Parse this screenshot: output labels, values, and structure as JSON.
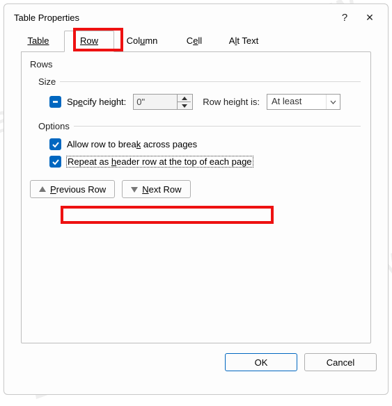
{
  "title": "Table Properties",
  "help_glyph": "?",
  "close_glyph": "✕",
  "tabs": {
    "table": "Table",
    "row": "Row",
    "column": "Column",
    "cell": "Cell",
    "alttext_pre": "A",
    "alttext_u": "l",
    "alttext_post": "t Text"
  },
  "rows_label": "Rows",
  "size": {
    "label": "Size",
    "specify_pre": "Sp",
    "specify_u": "e",
    "specify_post": "cify height:",
    "value": "0\"",
    "row_height_pre": "Row height ",
    "row_height_u": "i",
    "row_height_post": "s:",
    "mode": "At least"
  },
  "options": {
    "label_u": "O",
    "label_post": "ptions",
    "allow_pre": "Allow row to brea",
    "allow_u": "k",
    "allow_post": " across pages",
    "repeat_pre": "Repeat as ",
    "repeat_u": "h",
    "repeat_post": "eader row at the top of each page"
  },
  "nav": {
    "prev_u": "P",
    "prev_post": "revious Row",
    "next_u": "N",
    "next_post": "ext Row"
  },
  "footer": {
    "ok": "OK",
    "cancel": "Cancel"
  },
  "watermark": "BARDIMIN"
}
